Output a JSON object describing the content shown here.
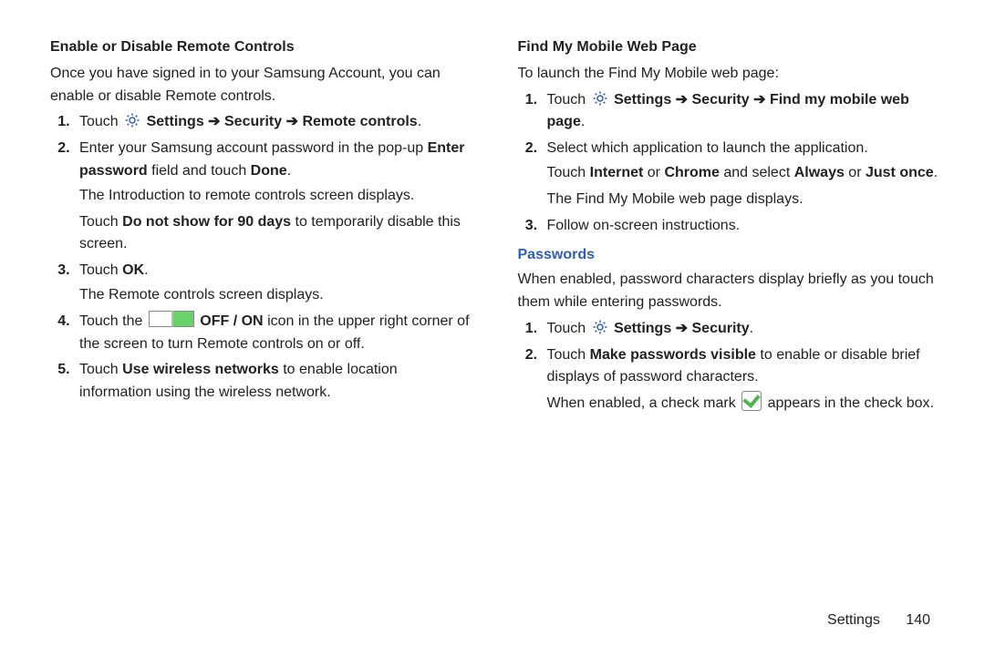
{
  "left": {
    "heading": "Enable or Disable Remote Controls",
    "intro": "Once you have signed in to your Samsung Account, you can enable or disable Remote controls.",
    "items": {
      "i1_a": "Touch ",
      "i1_b": "Settings ➔ Security ➔ Remote controls",
      "i1_c": ".",
      "i2_a": "Enter your Samsung account password in the pop-up ",
      "i2_b": "Enter password",
      "i2_c": " field and touch ",
      "i2_d": "Done",
      "i2_e": ".",
      "i2_cont1": "The Introduction to remote controls screen displays.",
      "i2_cont2a": "Touch ",
      "i2_cont2b": "Do not show for 90 days",
      "i2_cont2c": " to temporarily disable this screen.",
      "i3_a": "Touch ",
      "i3_b": "OK",
      "i3_c": ".",
      "i3_cont": "The Remote controls screen displays.",
      "i4_a": "Touch the ",
      "i4_b": "OFF / ON",
      "i4_c": " icon in the upper right corner of the screen to turn Remote controls on or off.",
      "i5_a": "Touch ",
      "i5_b": "Use wireless networks",
      "i5_c": " to enable location information using the wireless network."
    }
  },
  "right": {
    "heading1": "Find My Mobile Web Page",
    "intro1": "To launch the Find My Mobile web page:",
    "items1": {
      "i1_a": "Touch ",
      "i1_b": "Settings ➔ Security ➔ Find my mobile web page",
      "i1_c": ".",
      "i2_a": "Select which application to launch the application.",
      "i2_cont_a": "Touch ",
      "i2_cont_b": "Internet",
      "i2_cont_c": " or ",
      "i2_cont_d": "Chrome",
      "i2_cont_e": " and select ",
      "i2_cont_f": "Always",
      "i2_cont_g": " or ",
      "i2_cont_h": "Just once",
      "i2_cont_i": ".",
      "i2_cont2": "The Find My Mobile web page displays.",
      "i3": "Follow on-screen instructions."
    },
    "heading2": "Passwords",
    "intro2": "When enabled, password characters display briefly as you touch them while entering passwords.",
    "items2": {
      "i1_a": "Touch ",
      "i1_b": "Settings ➔ Security",
      "i1_c": ".",
      "i2_a": "Touch ",
      "i2_b": "Make passwords visible",
      "i2_c": " to enable or disable brief displays of password characters.",
      "i2_cont_a": "When enabled, a check mark ",
      "i2_cont_b": " appears in the check box."
    }
  },
  "footer": {
    "section": "Settings",
    "page": "140"
  }
}
